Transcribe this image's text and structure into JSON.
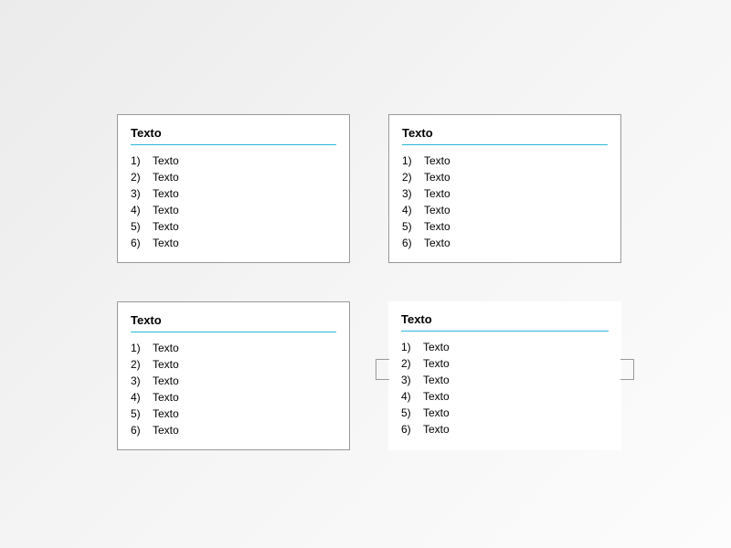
{
  "cards": [
    {
      "title": "Texto",
      "items": [
        {
          "num": "1)",
          "text": "Texto"
        },
        {
          "num": "2)",
          "text": "Texto"
        },
        {
          "num": "3)",
          "text": "Texto"
        },
        {
          "num": "4)",
          "text": "Texto"
        },
        {
          "num": "5)",
          "text": "Texto"
        },
        {
          "num": "6)",
          "text": "Texto"
        }
      ]
    },
    {
      "title": "Texto",
      "items": [
        {
          "num": "1)",
          "text": "Texto"
        },
        {
          "num": "2)",
          "text": "Texto"
        },
        {
          "num": "3)",
          "text": "Texto"
        },
        {
          "num": "4)",
          "text": "Texto"
        },
        {
          "num": "5)",
          "text": "Texto"
        },
        {
          "num": "6)",
          "text": "Texto"
        }
      ]
    },
    {
      "title": "Texto",
      "items": [
        {
          "num": "1)",
          "text": "Texto"
        },
        {
          "num": "2)",
          "text": "Texto"
        },
        {
          "num": "3)",
          "text": "Texto"
        },
        {
          "num": "4)",
          "text": "Texto"
        },
        {
          "num": "5)",
          "text": "Texto"
        },
        {
          "num": "6)",
          "text": "Texto"
        }
      ]
    },
    {
      "title": "Texto",
      "items": [
        {
          "num": "1)",
          "text": "Texto"
        },
        {
          "num": "2)",
          "text": "Texto"
        },
        {
          "num": "3)",
          "text": "Texto"
        },
        {
          "num": "4)",
          "text": "Texto"
        },
        {
          "num": "5)",
          "text": "Texto"
        },
        {
          "num": "6)",
          "text": "Texto"
        }
      ]
    }
  ]
}
